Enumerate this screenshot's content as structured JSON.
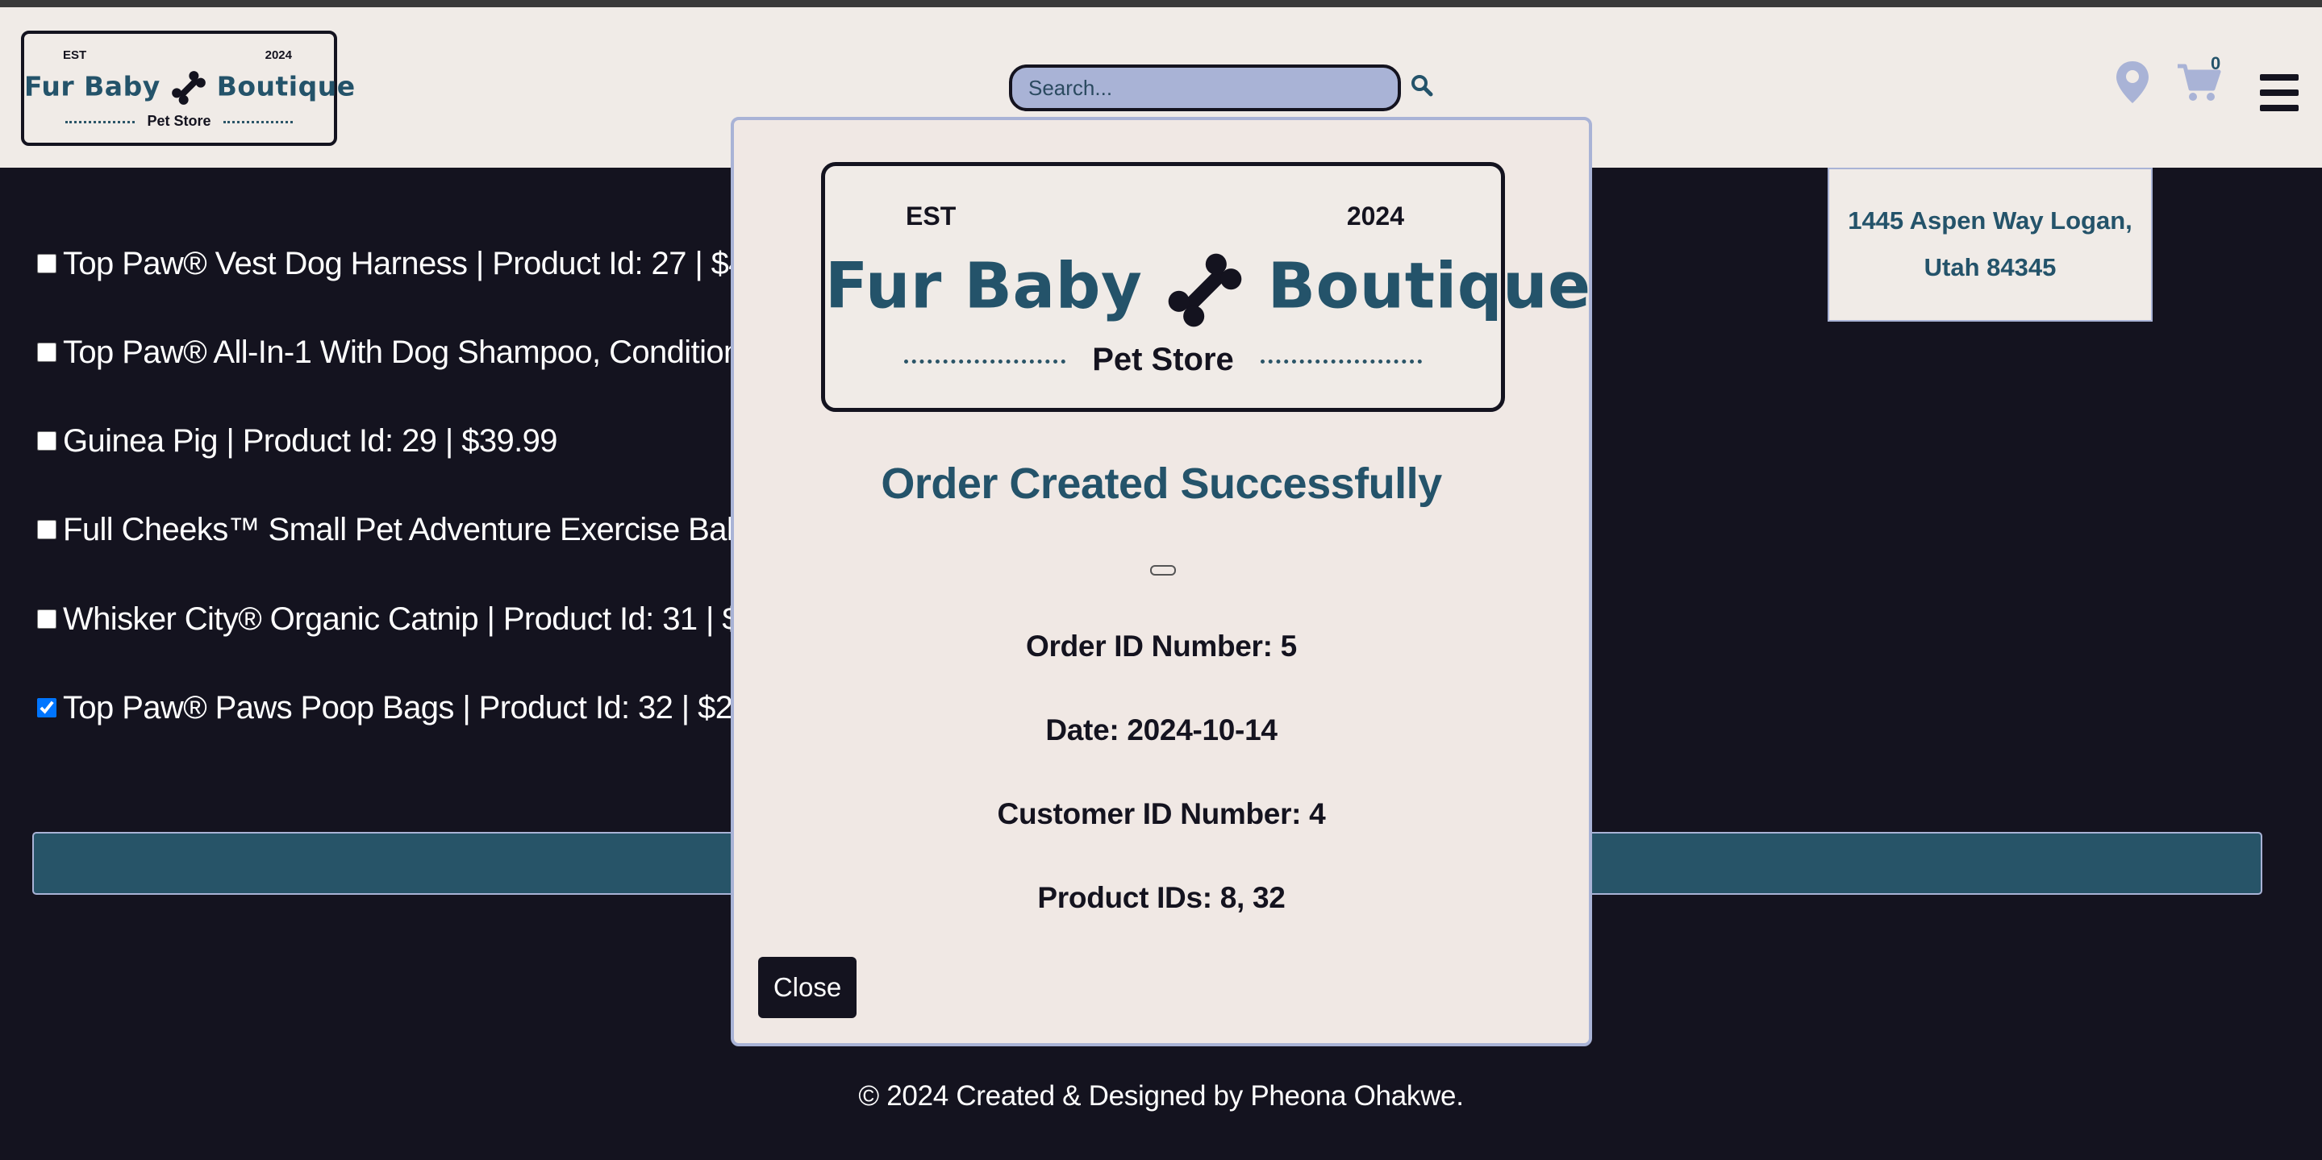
{
  "header": {
    "logo": {
      "est": "EST",
      "year": "2024",
      "brand_left": "Fur Baby",
      "brand_right": "Boutique",
      "subtitle": "Pet Store"
    },
    "search": {
      "placeholder": "Search..."
    },
    "cart_count": "0",
    "icons": [
      "search-icon",
      "location-icon",
      "cart-icon",
      "menu-icon"
    ]
  },
  "address": {
    "line1": "1445 Aspen Way Logan,",
    "line2": "Utah 84345"
  },
  "products": [
    {
      "label": "Top Paw® Vest Dog Harness | Product Id: 27 | $4.99",
      "checked": false
    },
    {
      "label": "Top Paw® All-In-1 With Dog Shampoo, Conditioner,",
      "checked": false
    },
    {
      "label": "Guinea Pig | Product Id: 29 | $39.99",
      "checked": false
    },
    {
      "label": "Full Cheeks™ Small Pet Adventure Exercise Ball | P",
      "checked": false
    },
    {
      "label": "Whisker City® Organic Catnip | Product Id: 31 | $3.9",
      "checked": false
    },
    {
      "label": "Top Paw® Paws Poop Bags | Product Id: 32 | $2",
      "checked": true
    }
  ],
  "modal": {
    "logo": {
      "est": "EST",
      "year": "2024",
      "brand_left": "Fur Baby",
      "brand_right": "Boutique",
      "subtitle": "Pet Store"
    },
    "title": "Order Created Successfully",
    "order_id": "Order ID Number: 5",
    "date": "Date: 2024-10-14",
    "customer_id": "Customer ID Number: 4",
    "product_ids": "Product IDs: 8, 32",
    "close_label": "Close"
  },
  "footer": {
    "text": "© 2024 Created & Designed by Pheona Ohakwe."
  },
  "colors": {
    "background": "#14131f",
    "header": "#f0ebe7",
    "accent": "#24536a",
    "search_fill": "#a9b3d6"
  }
}
